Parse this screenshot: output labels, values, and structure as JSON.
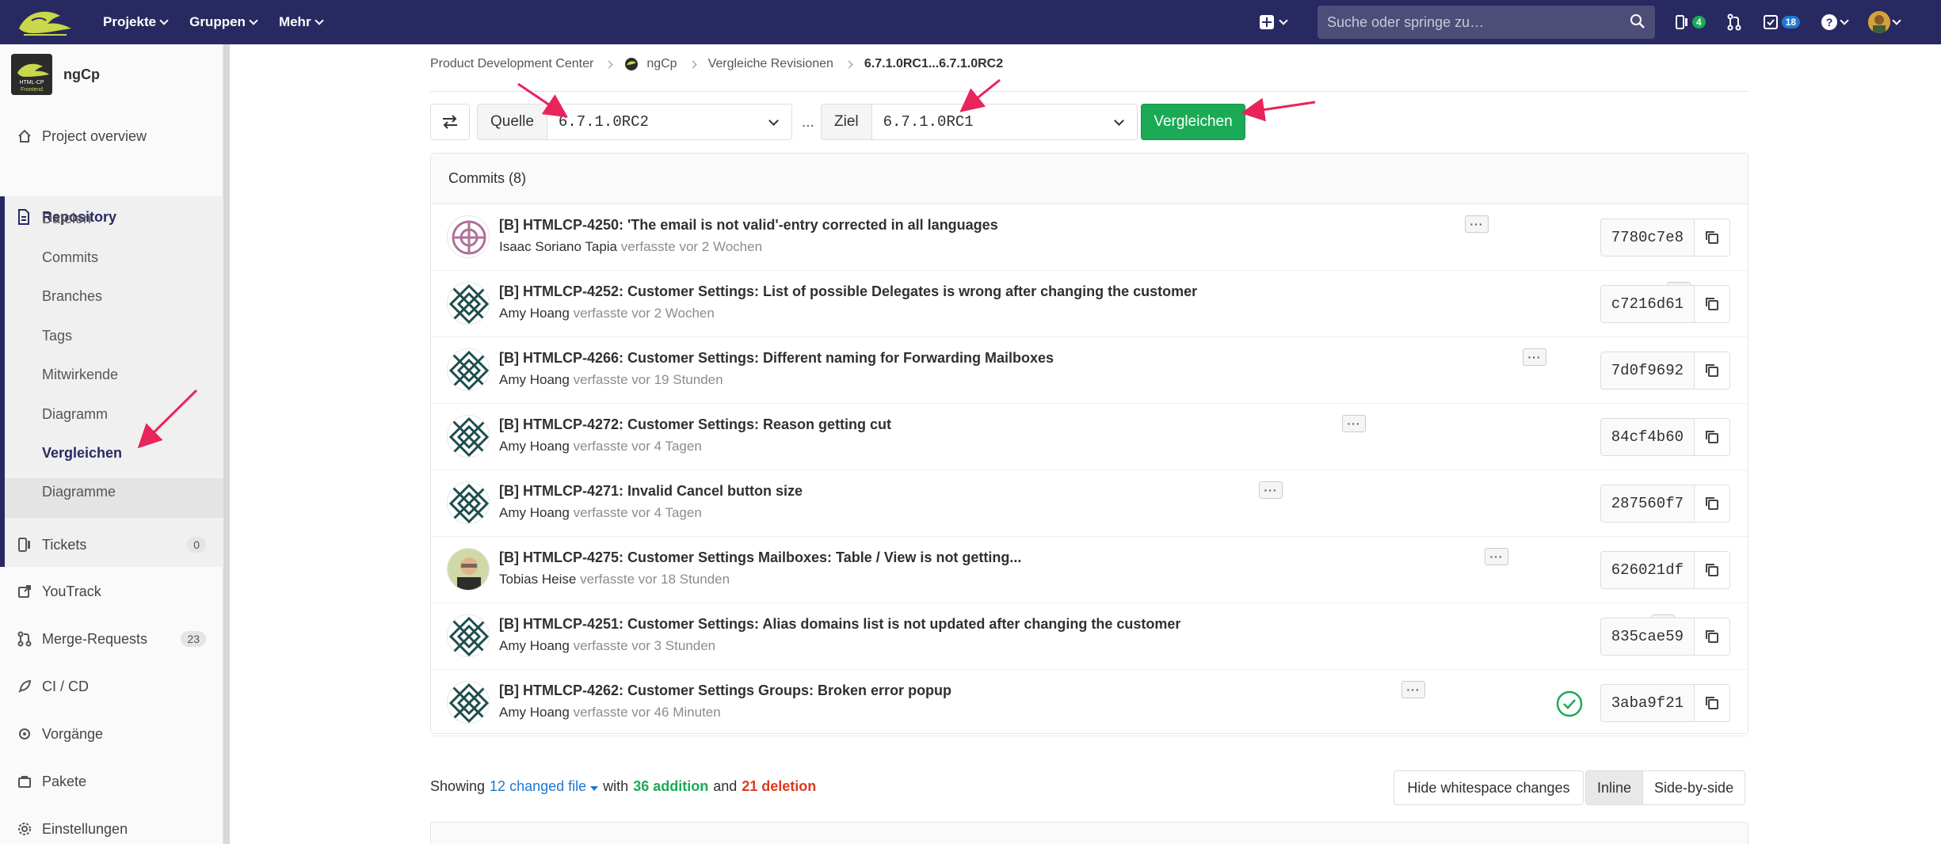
{
  "navbar": {
    "menu": [
      {
        "label": "Projekte"
      },
      {
        "label": "Gruppen"
      },
      {
        "label": "Mehr"
      }
    ],
    "search_placeholder": "Suche oder springe zu…",
    "issues_count": "4",
    "todos_count": "18"
  },
  "project": {
    "name": "ngCp",
    "avatar_text_line1": "HTML-CP",
    "avatar_text_line2": "Frontend"
  },
  "sidebar": {
    "project_overview": "Project overview",
    "repository": "Repository",
    "repo_items": [
      "Dateien",
      "Commits",
      "Branches",
      "Tags",
      "Mitwirkende",
      "Diagramm",
      "Vergleichen",
      "Diagramme"
    ],
    "tickets": "Tickets",
    "tickets_count": "0",
    "youtrack": "YouTrack",
    "merge_requests": "Merge-Requests",
    "merge_requests_count": "23",
    "cicd": "CI / CD",
    "operations": "Vorgänge",
    "packages": "Pakete",
    "settings": "Einstellungen"
  },
  "breadcrumb": {
    "items": [
      "Product Development Center",
      "ngCp",
      "Vergleiche Revisionen"
    ],
    "current": "6.7.1.0RC1...6.7.1.0RC2"
  },
  "compare": {
    "source_label": "Quelle",
    "source_value": "6.7.1.0RC2",
    "dots": "...",
    "target_label": "Ziel",
    "target_value": "6.7.1.0RC1",
    "button": "Vergleichen"
  },
  "commits": {
    "header": "Commits (8)",
    "list": [
      {
        "title": "[B] HTMLCP-4250: 'The email is not valid'-entry corrected in all languages",
        "author": "Isaac Soriano Tapia",
        "authored": "verfasste vor 2 Wochen",
        "sha": "7780c7e8"
      },
      {
        "title": "[B] HTMLCP-4252: Customer Settings: List of possible Delegates is wrong after changing the customer",
        "author": "Amy Hoang",
        "authored": "verfasste vor 2 Wochen",
        "sha": "c7216d61"
      },
      {
        "title": "[B] HTMLCP-4266: Customer Settings: Different naming for Forwarding Mailboxes",
        "author": "Amy Hoang",
        "authored": "verfasste vor 19 Stunden",
        "sha": "7d0f9692"
      },
      {
        "title": "[B] HTMLCP-4272: Customer Settings: Reason getting cut",
        "author": "Amy Hoang",
        "authored": "verfasste vor 4 Tagen",
        "sha": "84cf4b60"
      },
      {
        "title": "[B] HTMLCP-4271: Invalid Cancel button size",
        "author": "Amy Hoang",
        "authored": "verfasste vor 4 Tagen",
        "sha": "287560f7"
      },
      {
        "title": "[B] HTMLCP-4275: Customer Settings Mailboxes: Table / View is not getting...",
        "author": "Tobias Heise",
        "authored": "verfasste vor 18 Stunden",
        "sha": "626021df"
      },
      {
        "title": "[B] HTMLCP-4251: Customer Settings: Alias domains list is not updated after changing the customer",
        "author": "Amy Hoang",
        "authored": "verfasste vor 3 Stunden",
        "sha": "835cae59"
      },
      {
        "title": "[B] HTMLCP-4262: Customer Settings Groups: Broken error popup",
        "author": "Amy Hoang",
        "authored": "verfasste vor 46 Minuten",
        "sha": "3aba9f21",
        "pipeline": "passed"
      }
    ]
  },
  "summary": {
    "showing": "Showing",
    "changed": "12 changed file",
    "with": "with",
    "additions": "36 addition",
    "and": "and",
    "deletions": "21 deletion",
    "hide_ws": "Hide whitespace changes",
    "inline": "Inline",
    "side_by_side": "Side-by-side"
  },
  "colors": {
    "navbar": "#292961",
    "success": "#1aaa55",
    "link": "#1f78d1",
    "danger": "#db3b21",
    "annotation_arrow": "#e8245a"
  }
}
